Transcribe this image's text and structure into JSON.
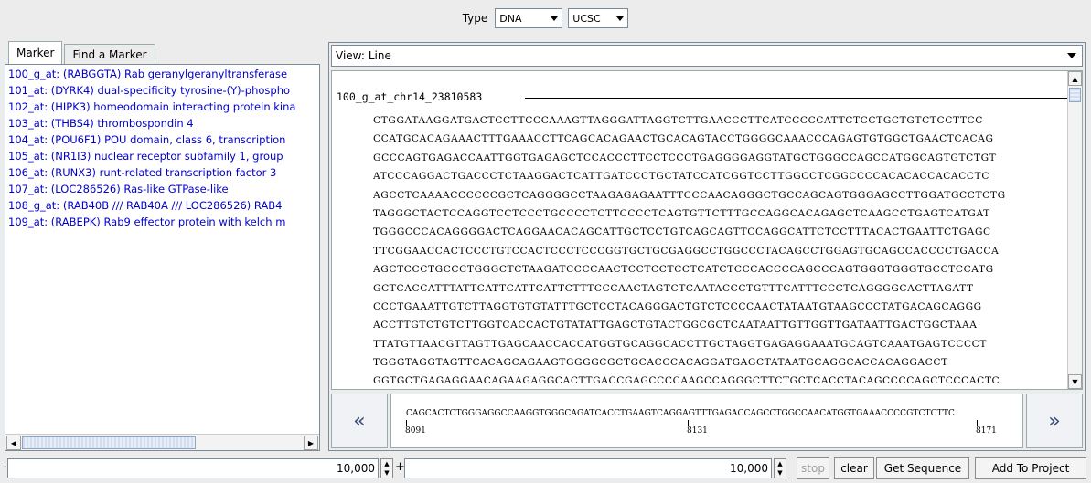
{
  "top": {
    "type_label": "Type",
    "type_value": "DNA",
    "source_value": "UCSC"
  },
  "left": {
    "tabs": [
      "Marker",
      "Find a Marker"
    ],
    "markers": [
      "100_g_at: (RABGGTA) Rab geranylgeranyltransferase",
      "101_at: (DYRK4) dual-specificity tyrosine-(Y)-phospho",
      "102_at: (HIPK3) homeodomain interacting protein kina",
      "103_at: (THBS4) thrombospondin 4",
      "104_at: (POU6F1) POU domain, class 6, transcription",
      "105_at: (NR1I3) nuclear receptor subfamily 1, group",
      "106_at: (RUNX3) runt-related transcription factor 3",
      "107_at: (LOC286526) Ras-like GTPase-like",
      "108_g_at: (RAB40B /// RAB40A /// LOC286526) RAB4",
      "109_at: (RABEPK) Rab9 effector protein with kelch m"
    ]
  },
  "right": {
    "view_label": "View:",
    "view_value": "Line",
    "seq_title": "100_g_at_chr14_23810583",
    "sequence_lines": [
      "CTGGATAAGGATGACTCCTTCCCAAAGTTAGGGATTAGGTCTTGAACCCTTCATCCCCCATTCTCCTGCTGTCTCCTTCC",
      "CCATGCACAGAAACTTTGAAACCTTCAGCACAGAACTGCACAGTACCTGGGGCAAACCCAGAGTGTGGCTGAACTCACAG",
      "GCCCAGTGAGACCAATTGGTGAGAGCTCCACCCTTCCTCCCTGAGGGGAGGTATGCTGGGCCAGCCATGGCAGTGTCTGT",
      "ATCCCAGGACTGACCCTCTAAGGACTCATTGATCCCTGCTATCCATCGGTCCTTGGCCTCGGCCCCACACACCACACCTC",
      "AGCCTCAAAACCCCCCGCTCAGGGGCCTAAGAGAGAATTTCCCAACAGGGCTGCCAGCAGTGGGAGCCTTGGATGCCTCTG",
      "TAGGGCTACTCCAGGTCCTCCCTGCCCCTCTTCCCCTCAGTGTTCTTTGCCAGGCACAGAGCTCAAGCCTGAGTCATGAT",
      "TGGGCCCACAGGGGACTCAGGAACACAGCATTGCTCCTGTCAGCAGTTCCAGGCATTCTCCTTTACACTGAATTCTGAGC",
      "TTCGGAACCACTCCCTGTCCACTCCCTCCCGGTGCTGCGAGGCCTGGCCCTACAGCCTGGAGTGCAGCCACCCCTGACCA",
      "AGCTCCCTGCCCTGGGCTCTAAGATCCCCAACTCCTCCTCCTCATCTCCCACCCCAGCCCAGTGGGTGGGTGCCTCCATG",
      "GCTCACCATTTATTCATTCATTCATTCTTTCCCAACTAGTCTCAATACCCTGTTTCATTTCCCTCAGGGGCACTTAGATT",
      "CCCTGAAATTGTCTTAGGTGTGTATTTGCTCCTACAGGGACTGTCTCCCCAACTATAATGTAAGCCCTATGACAGCAGGG",
      "ACCTTGTCTGTCTTGGTCACCACTGTATATTGAGCTGTACTGGCGCTCAATAATTGTTGGTTGATAATTGACTGGCTAAA",
      "TTATGTTAACGTTAGTTGAGCAACCACCATGGTGCAGGCACCTTGCTAGGTGAGAGGAAATGCAGTCAAATGAGTCCCCT",
      "TGGGTAGGTAGTTCACAGCAGAAGTGGGGCGCTGCACCCACAGGATGAGCTATAATGCAGGCACCACAGGACCT",
      "GGTGCTGAGAGGAACAGAAGAGGCACTTGACCGAGCCCCAAGCCAGGGCTTCTGCTCACCTACAGCCCCAGCTCCCACTC"
    ],
    "scan_sequence": "CAGCACTCTGGGAGGCCAAGGTGGGCAGATCACCTGAAGTCAGGAGTTTGAGACCAGCCTGGCCAACATGGTGAAACCCCGTCTCTTC",
    "ticks": [
      "8091",
      "8131",
      "8171"
    ]
  },
  "bottom": {
    "left_value": "10,000",
    "right_value": "10,000",
    "minus": "-",
    "plus": "+",
    "stop": "stop",
    "clear": "clear",
    "get_sequence": "Get Sequence",
    "add_to_project": "Add To Project"
  }
}
